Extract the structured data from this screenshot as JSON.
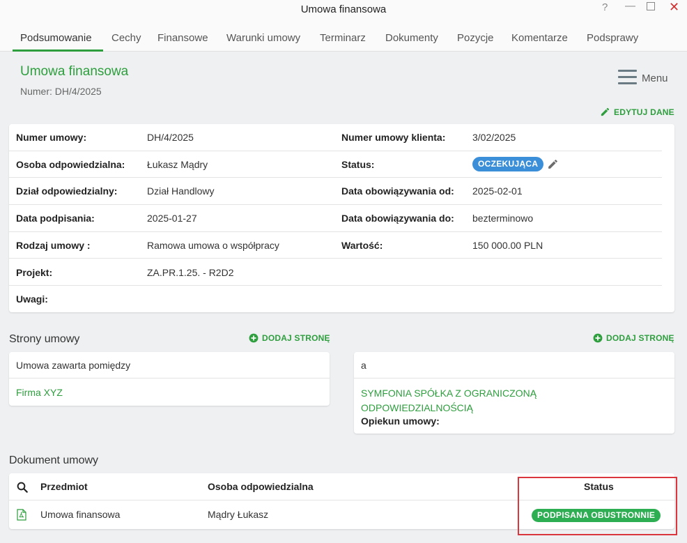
{
  "window": {
    "title": "Umowa finansowa"
  },
  "tabs": [
    {
      "label": "Podsumowanie",
      "active": true
    },
    {
      "label": "Cechy"
    },
    {
      "label": "Finansowe"
    },
    {
      "label": "Warunki umowy"
    },
    {
      "label": "Terminarz"
    },
    {
      "label": "Dokumenty"
    },
    {
      "label": "Pozycje"
    },
    {
      "label": "Komentarze"
    },
    {
      "label": "Podsprawy"
    }
  ],
  "header": {
    "title": "Umowa finansowa",
    "number": "Numer: DH/4/2025",
    "menu_label": "Menu",
    "edit_label": "EDYTUJ DANE"
  },
  "details": {
    "rows": [
      {
        "l1": "Numer umowy:",
        "v1": "DH/4/2025",
        "l2": "Numer umowy klienta:",
        "v2": "3/02/2025"
      },
      {
        "l1": "Osoba odpowiedzialna:",
        "v1": "Łukasz Mądry",
        "l2": "Status:",
        "v2": ""
      },
      {
        "l1": "Dział odpowiedzialny:",
        "v1": "Dział Handlowy",
        "l2": "Data obowiązywania od:",
        "v2": "2025-02-01"
      },
      {
        "l1": "Data podpisania:",
        "v1": "2025-01-27",
        "l2": "Data obowiązywania do:",
        "v2": "bezterminowo"
      },
      {
        "l1": "Rodzaj umowy :",
        "v1": "Ramowa umowa o współpracy",
        "l2": "Wartość:",
        "v2": "150 000.00 PLN"
      },
      {
        "l1": "Projekt:",
        "v1": "ZA.PR.1.25. - R2D2",
        "l2": "",
        "v2": ""
      },
      {
        "l1": "Uwagi:",
        "v1": "",
        "l2": "",
        "v2": ""
      }
    ],
    "status_badge": "OCZEKUJĄCA"
  },
  "parties": {
    "title": "Strony umowy",
    "add_label": "DODAJ STRONĘ",
    "left": {
      "head": "Umowa zawarta pomiędzy",
      "name": "Firma XYZ"
    },
    "right": {
      "head": "a",
      "name_line1": "SYMFONIA SPÓŁKA Z OGRANICZONĄ",
      "name_line2": "ODPOWIEDZIALNOŚCIĄ",
      "guardian_label": "Opiekun umowy:"
    }
  },
  "document": {
    "title": "Dokument umowy",
    "columns": {
      "subject": "Przedmiot",
      "person": "Osoba odpowiedzialna",
      "status": "Status"
    },
    "row": {
      "subject": "Umowa finansowa",
      "person": "Mądry Łukasz",
      "status": "PODPISANA OBUSTRONNIE"
    }
  },
  "colors": {
    "accent": "#2e9e3e",
    "status_blue": "#3b8fd9",
    "status_green": "#2eae52",
    "highlight": "#d9363e"
  }
}
